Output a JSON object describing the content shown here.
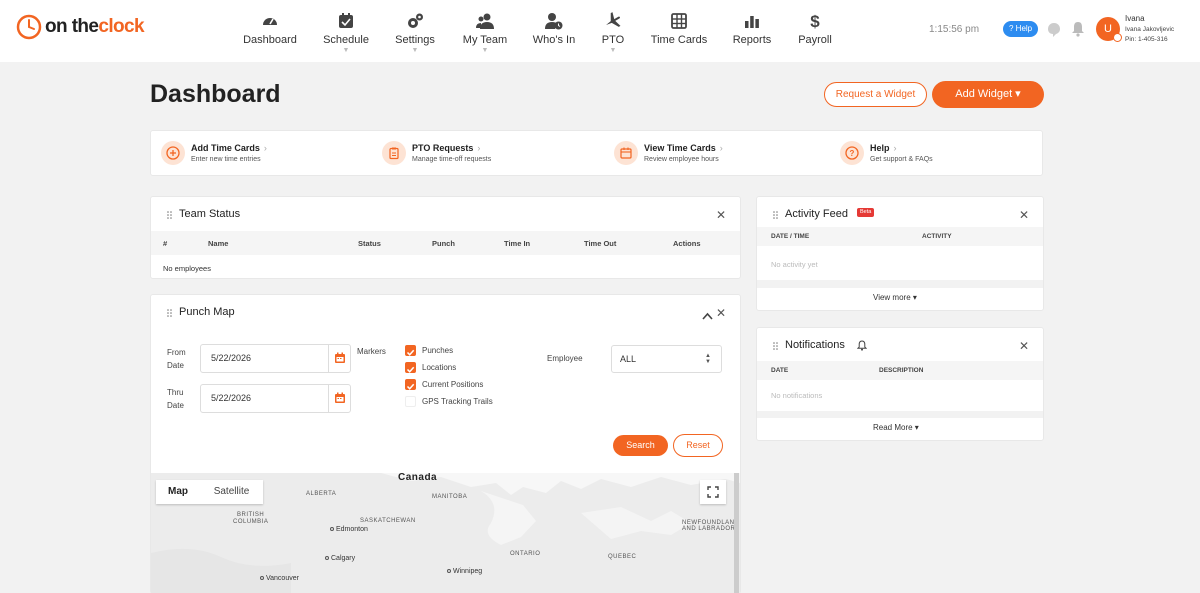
{
  "brand": {
    "logo_word_1": "on the",
    "logo_word_2": "clock"
  },
  "nav": [
    {
      "label": "Dashboard",
      "has_menu": false
    },
    {
      "label": "Schedule",
      "has_menu": true
    },
    {
      "label": "Settings",
      "has_menu": true
    },
    {
      "label": "My Team",
      "has_menu": true
    },
    {
      "label": "Who's In",
      "has_menu": false
    },
    {
      "label": "PTO",
      "has_menu": true
    },
    {
      "label": "Time Cards",
      "has_menu": false
    },
    {
      "label": "Reports",
      "has_menu": false
    },
    {
      "label": "Payroll",
      "has_menu": false
    }
  ],
  "header": {
    "time": "1:15:56 pm",
    "help_label": "? Help",
    "user": {
      "initial": "U",
      "first_name": "Ivana",
      "full_name": "Ivana Jakovljevic",
      "pin": "Pin: 1-405-316"
    }
  },
  "page": {
    "title": "Dashboard",
    "request_widget_label": "Request a Widget",
    "add_widget_label": "Add Widget ▾"
  },
  "quick_links": [
    {
      "title": "Add Time Cards",
      "subtitle": "Enter new time entries",
      "icon": "plus-circle-icon"
    },
    {
      "title": "PTO Requests",
      "subtitle": "Manage time-off requests",
      "icon": "clipboard-icon"
    },
    {
      "title": "View Time Cards",
      "subtitle": "Review employee hours",
      "icon": "calendar-icon"
    },
    {
      "title": "Help",
      "subtitle": "Get support & FAQs",
      "icon": "question-icon"
    }
  ],
  "team_status": {
    "title": "Team Status",
    "columns": [
      "#",
      "Name",
      "Status",
      "Punch",
      "Time In",
      "Time Out",
      "Actions"
    ],
    "empty": "No employees"
  },
  "punch_map": {
    "title": "Punch Map",
    "from_label_1": "From",
    "from_label_2": "Date",
    "from_value": "5/22/2026",
    "thru_label_1": "Thru",
    "thru_label_2": "Date",
    "thru_value": "5/22/2026",
    "markers_label": "Markers",
    "markers": [
      {
        "label": "Punches",
        "checked": true
      },
      {
        "label": "Locations",
        "checked": true
      },
      {
        "label": "Current Positions",
        "checked": true
      },
      {
        "label": "GPS Tracking Trails",
        "checked": false
      }
    ],
    "employee_label": "Employee",
    "employee_value": "ALL",
    "search_label": "Search",
    "reset_label": "Reset",
    "map": {
      "map_tab": "Map",
      "satellite_tab": "Satellite",
      "country": "Canada",
      "regions": [
        "ALBERTA",
        "MANITOBA",
        "BRITISH",
        "COLUMBIA",
        "SASKATCHEWAN",
        "ONTARIO",
        "QUEBEC",
        "NEWFOUNDLAND",
        "AND LABRADOR"
      ],
      "cities": [
        "Edmonton",
        "Calgary",
        "Vancouver",
        "Winnipeg"
      ]
    }
  },
  "activity_feed": {
    "title": "Activity Feed",
    "badge": "Beta",
    "columns": [
      "DATE / TIME",
      "ACTIVITY"
    ],
    "empty": "No activity yet",
    "more_label": "View more ▾"
  },
  "notifications": {
    "title": "Notifications",
    "columns": [
      "DATE",
      "DESCRIPTION"
    ],
    "empty": "No notifications",
    "more_label": "Read More ▾"
  },
  "colors": {
    "accent": "#f26522",
    "help_blue": "#2d8cf0",
    "beta_red": "#e53935"
  }
}
